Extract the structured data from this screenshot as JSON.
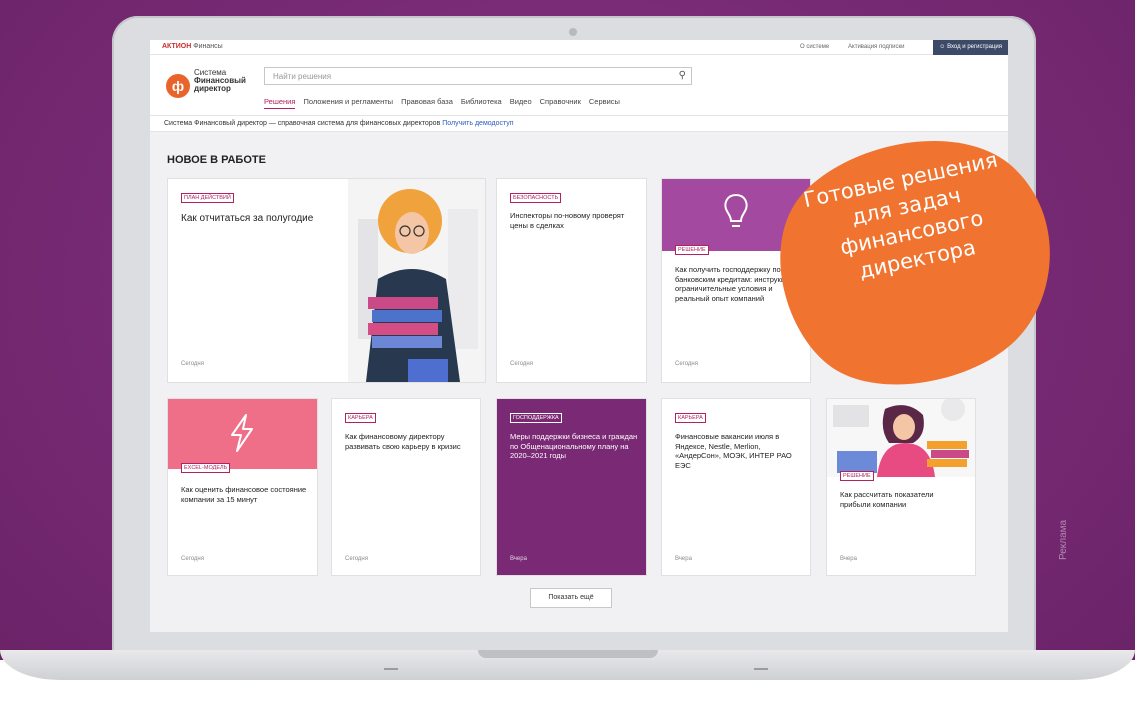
{
  "topbar": {
    "brand": "АКТИОН",
    "brand_sub": "Финансы",
    "links": [
      "О системе",
      "Активация подписки"
    ],
    "login": "Вход и регистрация"
  },
  "header": {
    "logo_lines": [
      "Система",
      "Финансовый",
      "директор"
    ],
    "search_placeholder": "Найти решения",
    "nav": [
      "Решения",
      "Положения и регламенты",
      "Правовая база",
      "Библиотека",
      "Видео",
      "Справочник",
      "Сервисы"
    ]
  },
  "promo": {
    "text": "Система Финансовый директор — справочная система для финансовых директоров",
    "link": "Получить демодоступ"
  },
  "main": {
    "section_title": "НОВОЕ В РАБОТЕ",
    "cards": [
      {
        "tag": "ПЛАН ДЕЙСТВИЙ",
        "title": "Как отчитаться за полугодие",
        "date": "Сегодня"
      },
      {
        "tag": "БЕЗОПАСНОСТЬ",
        "title": "Инспекторы по-новому проверят цены в сделках",
        "date": "Сегодня"
      },
      {
        "tag": "РЕШЕНИЕ",
        "title": "Как получить господдержку по банковским кредитам: инструкция, ограничительные условия и реальный опыт компаний",
        "date": "Сегодня"
      },
      {
        "tag": "EXCEL-МОДЕЛЬ",
        "title": "Как оценить финансовое состояние компании за 15 минут",
        "date": "Сегодня"
      },
      {
        "tag": "КАРЬЕРА",
        "title": "Как финансовому директору развивать свою карьеру в кризис",
        "date": "Сегодня"
      },
      {
        "tag": "ГОСПОДДЕРЖКА",
        "title": "Меры поддержки бизнеса и граждан по Общенациональному плану на 2020–2021 годы",
        "date": "Вчера"
      },
      {
        "tag": "КАРЬЕРА",
        "title": "Финансовые вакансии июля в Яндексе, Nestle, Merlion, «АндерСон», МОЭК, ИНТЕР РАО ЕЭС",
        "date": "Вчера"
      },
      {
        "tag": "РЕШЕНИЕ",
        "title": "Как рассчитать показатели прибыли компании",
        "date": "Вчера"
      }
    ],
    "show_more": "Показать ещё"
  },
  "badge": {
    "lines": [
      "Готовые решения",
      "для задач",
      "финансового",
      "директора"
    ],
    "color": "#f0732f"
  },
  "ad_label": "Реклама",
  "colors": {
    "background": "#7a2e78",
    "accent": "#b2225f",
    "purple_card": "#7a2a74",
    "pink_card": "#ef6e88"
  }
}
